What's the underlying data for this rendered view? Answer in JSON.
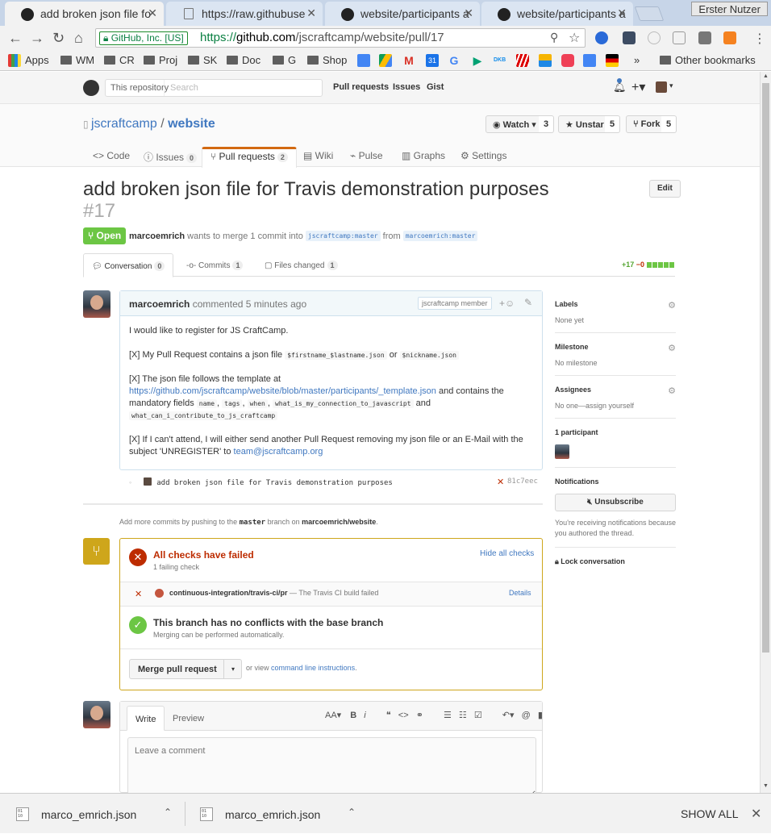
{
  "browser": {
    "tabs": [
      {
        "title": "add broken json file fo",
        "active": true
      },
      {
        "title": "https://raw.githubuse",
        "active": false
      },
      {
        "title": "website/participants a",
        "active": false
      },
      {
        "title": "website/participants a",
        "active": false
      }
    ],
    "user": "Erster Nutzer",
    "ev_label": "GitHub, Inc. [US]",
    "url_scheme": "https://",
    "url_host": "github.com",
    "url_path": "/jscraftcamp/website/pull/17",
    "bookmarks": [
      "Apps",
      "WM",
      "CR",
      "Proj",
      "SK",
      "Doc",
      "G",
      "Shop"
    ],
    "more_bookmarks": "»",
    "other_bookmarks": "Other bookmarks"
  },
  "github": {
    "scope_label": "This repository",
    "search_placeholder": "Search",
    "nav": [
      "Pull requests",
      "Issues",
      "Gist"
    ]
  },
  "repo": {
    "owner": "jscraftcamp",
    "sep": "/",
    "name": "website",
    "watch": {
      "label": "Watch ▾",
      "count": "3"
    },
    "unstar": {
      "label": "Unstar",
      "count": "5"
    },
    "fork": {
      "label": "Fork",
      "count": "5"
    },
    "tabs": {
      "code": "Code",
      "issues": {
        "label": "Issues",
        "count": "0"
      },
      "pulls": {
        "label": "Pull requests",
        "count": "2"
      },
      "wiki": "Wiki",
      "pulse": "Pulse",
      "graphs": "Graphs",
      "settings": "Settings"
    }
  },
  "pr": {
    "title": "add broken json file for Travis demonstration purposes",
    "number": "#17",
    "edit": "Edit",
    "state": "Open",
    "author": "marcoemrich",
    "meta_text": "wants to merge 1 commit into",
    "base": "jscraftcamp:master",
    "from": "from",
    "head": "marcoemrich:master",
    "tabs": {
      "conversation": {
        "label": "Conversation",
        "count": "0"
      },
      "commits": {
        "label": "Commits",
        "count": "1"
      },
      "files": {
        "label": "Files changed",
        "count": "1"
      }
    },
    "additions": "+17",
    "deletions": "−0"
  },
  "comment": {
    "author": "marcoemrich",
    "action": "commented",
    "time": "5 minutes ago",
    "badge": "jscraftcamp member",
    "p1": "I would like to register for JS CraftCamp.",
    "p2_text": "[X] My Pull Request contains a json file",
    "p2_code1": "$firstname_$lastname.json",
    "p2_or": "or",
    "p2_code2": "$nickname.json",
    "p3_text": "[X] The json file follows the template at",
    "p3_link": "https://github.com/jscraftcamp/website/blob/master/participants/_template.json",
    "p3_text2": "and contains the mandatory fields",
    "fields": [
      "name",
      "tags",
      "when",
      "what_is_my_connection_to_javascript",
      "what_can_i_contribute_to_js_craftcamp"
    ],
    "p3_and": "and",
    "p4_text": "[X] If I can't attend, I will either send another Pull Request removing my json file or an E-Mail with the subject 'UNREGISTER' to",
    "p4_email": "team@jscraftcamp.org"
  },
  "commit": {
    "message": "add broken json file for Travis demonstration purposes",
    "sha": "81c7eec"
  },
  "add_commits": {
    "text": "Add more commits by pushing to the",
    "branch": "master",
    "mid": "branch on",
    "repo": "marcoemrich/website",
    "end": "."
  },
  "merge": {
    "checks_title": "All checks have failed",
    "checks_sub": "1 failing check",
    "hide": "Hide all checks",
    "check_name": "continuous-integration/travis-ci/pr",
    "check_desc": "— The Travis CI build failed",
    "details": "Details",
    "conflicts_title": "This branch has no conflicts with the base branch",
    "conflicts_sub": "Merging can be performed automatically.",
    "button": "Merge pull request",
    "or_view": "or view",
    "cli_link": "command line instructions",
    "cli_end": "."
  },
  "sidebar": {
    "labels": {
      "title": "Labels",
      "value": "None yet"
    },
    "milestone": {
      "title": "Milestone",
      "value": "No milestone"
    },
    "assignees": {
      "title": "Assignees",
      "value": "No one—assign yourself"
    },
    "participants": {
      "title": "1 participant"
    },
    "notifications": {
      "title": "Notifications",
      "button": "Unsubscribe",
      "text": "You're receiving notifications because you authored the thread."
    },
    "lock": "Lock conversation"
  },
  "new_comment": {
    "write": "Write",
    "preview": "Preview",
    "placeholder": "Leave a comment"
  },
  "downloads": {
    "files": [
      "marco_emrich.json",
      "marco_emrich.json"
    ],
    "show_all": "SHOW ALL"
  }
}
